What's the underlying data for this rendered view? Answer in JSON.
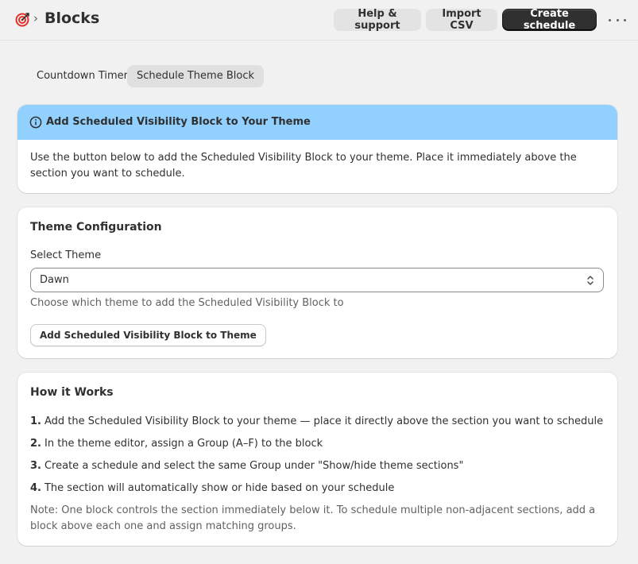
{
  "header": {
    "breadcrumb_chevron": "›",
    "title": "Blocks",
    "help_label": "Help & support",
    "import_label": "Import CSV",
    "create_label": "Create schedule"
  },
  "tabs": [
    {
      "label": "Countdown Timer",
      "active": false
    },
    {
      "label": "Schedule Theme Block",
      "active": true
    }
  ],
  "banner": {
    "title": "Add Scheduled Visibility Block to Your Theme",
    "body": "Use the button below to add the Scheduled Visibility Block to your theme. Place it immediately above the section you want to schedule.",
    "color": "#91d0ff"
  },
  "config": {
    "title": "Theme Configuration",
    "select_label": "Select Theme",
    "selected_theme": "Dawn",
    "help_text": "Choose which theme to add the Scheduled Visibility Block to",
    "add_button": "Add Scheduled Visibility Block to Theme"
  },
  "how": {
    "title": "How it Works",
    "steps": [
      {
        "num": "1.",
        "text": "Add the Scheduled Visibility Block to your theme — place it directly above the section you want to schedule"
      },
      {
        "num": "2.",
        "text": "In the theme editor, assign a Group (A–F) to the block"
      },
      {
        "num": "3.",
        "text": "Create a schedule and select the same Group under \"Show/hide theme sections\""
      },
      {
        "num": "4.",
        "text": "The section will automatically show or hide based on your schedule"
      }
    ],
    "note": "Note: One block controls the section immediately below it. To schedule multiple non-adjacent sections, add a block above each one and assign matching groups."
  },
  "colors": {
    "primary_button": "#303030",
    "app_logo": "#e0342a"
  }
}
